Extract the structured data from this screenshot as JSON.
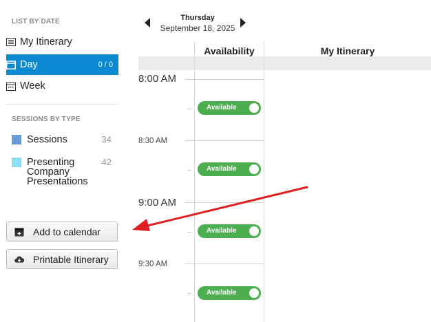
{
  "sidebar": {
    "list_header": "LIST BY DATE",
    "items": [
      {
        "label": "My Itinerary",
        "icon": "list-icon"
      },
      {
        "label": "Day",
        "icon": "calendar-day-icon",
        "count": "0 / 0"
      },
      {
        "label": "Week",
        "icon": "calendar-week-icon"
      }
    ],
    "types_header": "SESSIONS BY TYPE",
    "types": [
      {
        "label_lines": [
          "Sessions"
        ],
        "count": "34",
        "color": "#6a9bd8"
      },
      {
        "label_lines": [
          "Presenting",
          "Company",
          "Presentations"
        ],
        "count": "42",
        "color": "#8fdcf5"
      }
    ],
    "buttons": [
      {
        "label": "Add to calendar",
        "icon": "calendar-add-icon"
      },
      {
        "label": "Printable Itinerary",
        "icon": "cloud-download-icon"
      }
    ]
  },
  "date_nav": {
    "day": "Thursday",
    "date": "September 18, 2025"
  },
  "columns": {
    "availability": "Availability",
    "itinerary": "My Itinerary"
  },
  "times": [
    "8:00 AM",
    "8:30 AM",
    "9:00 AM",
    "9:30 AM"
  ],
  "slots": [
    {
      "label": "Available"
    },
    {
      "label": "Available"
    },
    {
      "label": "Available"
    },
    {
      "label": "Available"
    }
  ],
  "colors": {
    "accent": "#0c8ad1",
    "available": "#4cae4f",
    "annotation_arrow": "#e02020"
  }
}
